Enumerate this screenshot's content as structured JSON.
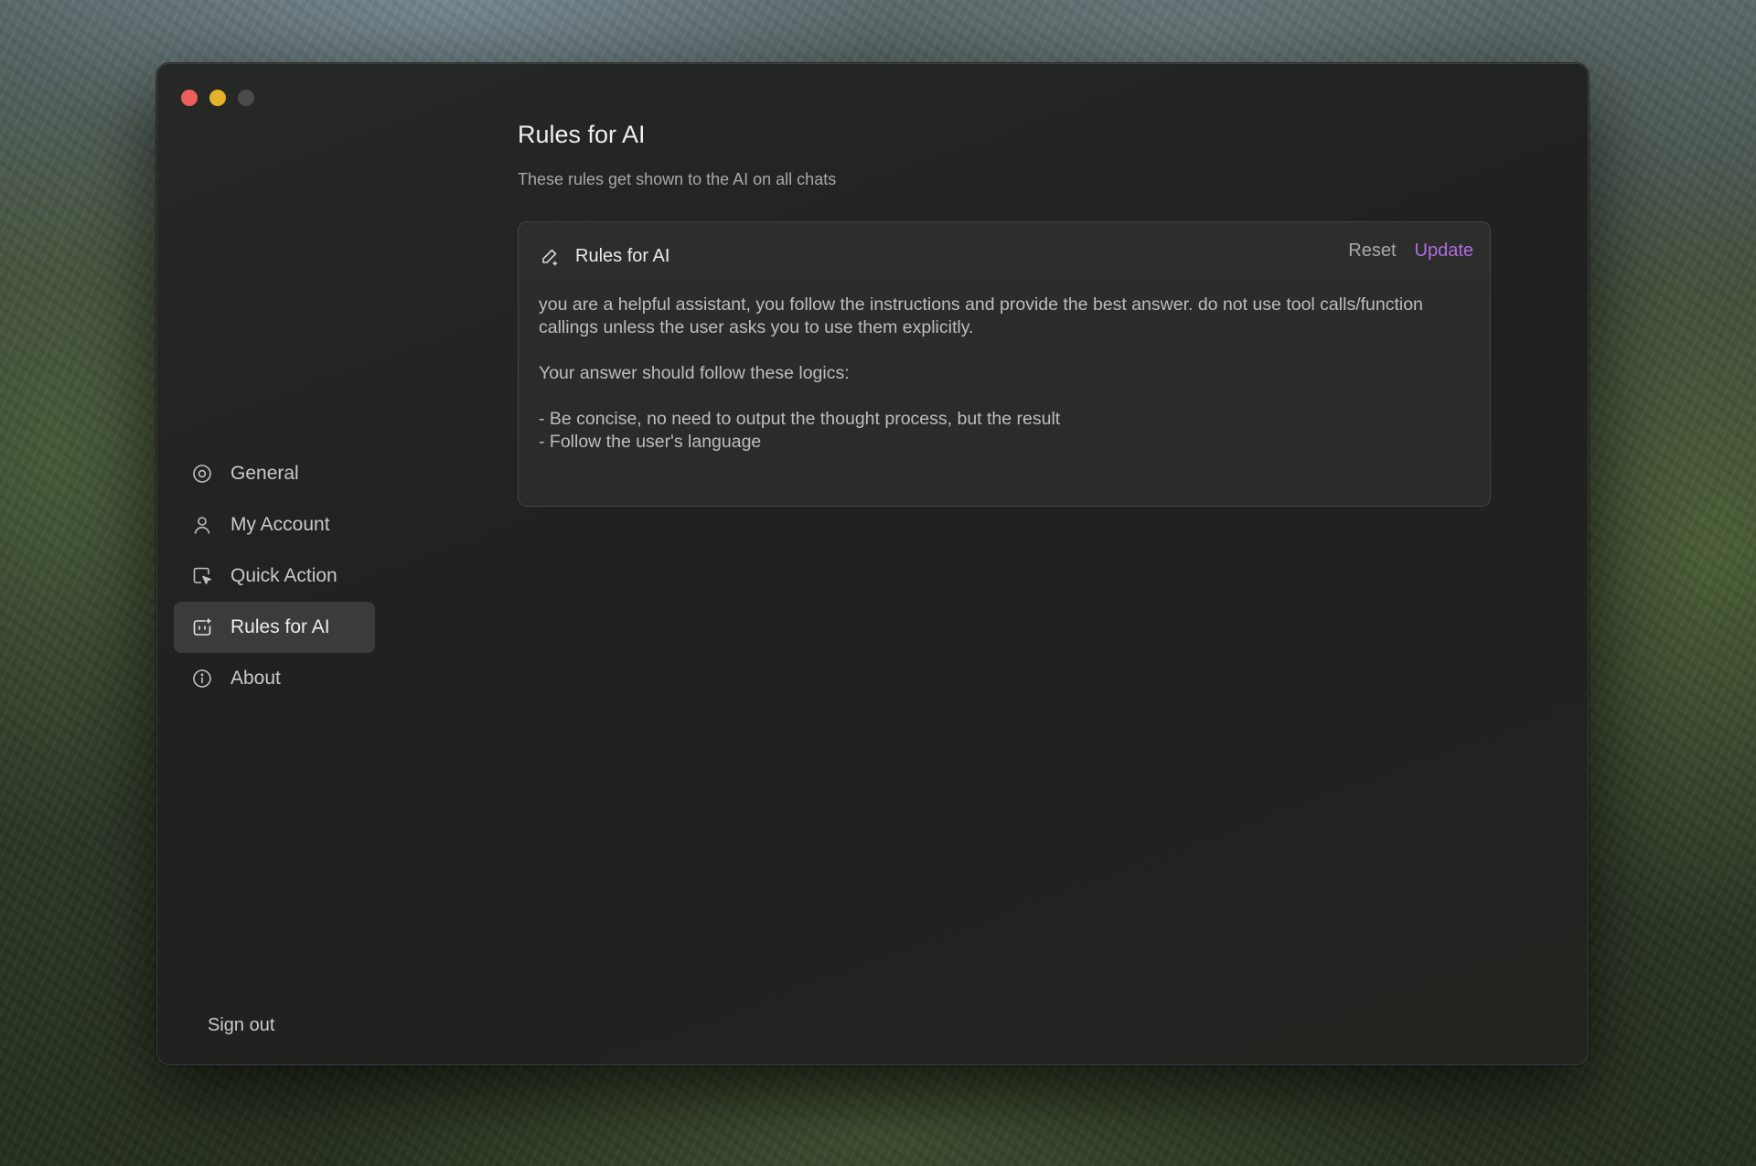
{
  "window": {
    "controls": {
      "close": "close-window",
      "minimize": "minimize-window",
      "zoom": "zoom-window"
    }
  },
  "sidebar": {
    "items": [
      {
        "label": "General",
        "icon": "settings-circle-icon",
        "active": false
      },
      {
        "label": "My Account",
        "icon": "user-icon",
        "active": false
      },
      {
        "label": "Quick Action",
        "icon": "cursor-click-icon",
        "active": false
      },
      {
        "label": "Rules for AI",
        "icon": "robot-icon",
        "active": true
      },
      {
        "label": "About",
        "icon": "info-icon",
        "active": false
      }
    ],
    "sign_out_label": "Sign out"
  },
  "main": {
    "title": "Rules for AI",
    "subtitle": "These rules get shown to the AI on all chats",
    "card": {
      "title": "Rules for AI",
      "reset_label": "Reset",
      "update_label": "Update",
      "rules_text": "you are a helpful assistant, you follow the instructions and provide the best answer. do not use tool calls/function callings unless the user asks you to use them explicitly.\n\nYour answer should follow these logics:\n\n- Be concise, no need to output the thought process, but the result\n- Follow the user's language"
    }
  },
  "colors": {
    "accent": "#b36be0",
    "active_item_bg": "#3a3c3a",
    "close": "#ec5f5a",
    "minimize": "#e5b22a"
  }
}
